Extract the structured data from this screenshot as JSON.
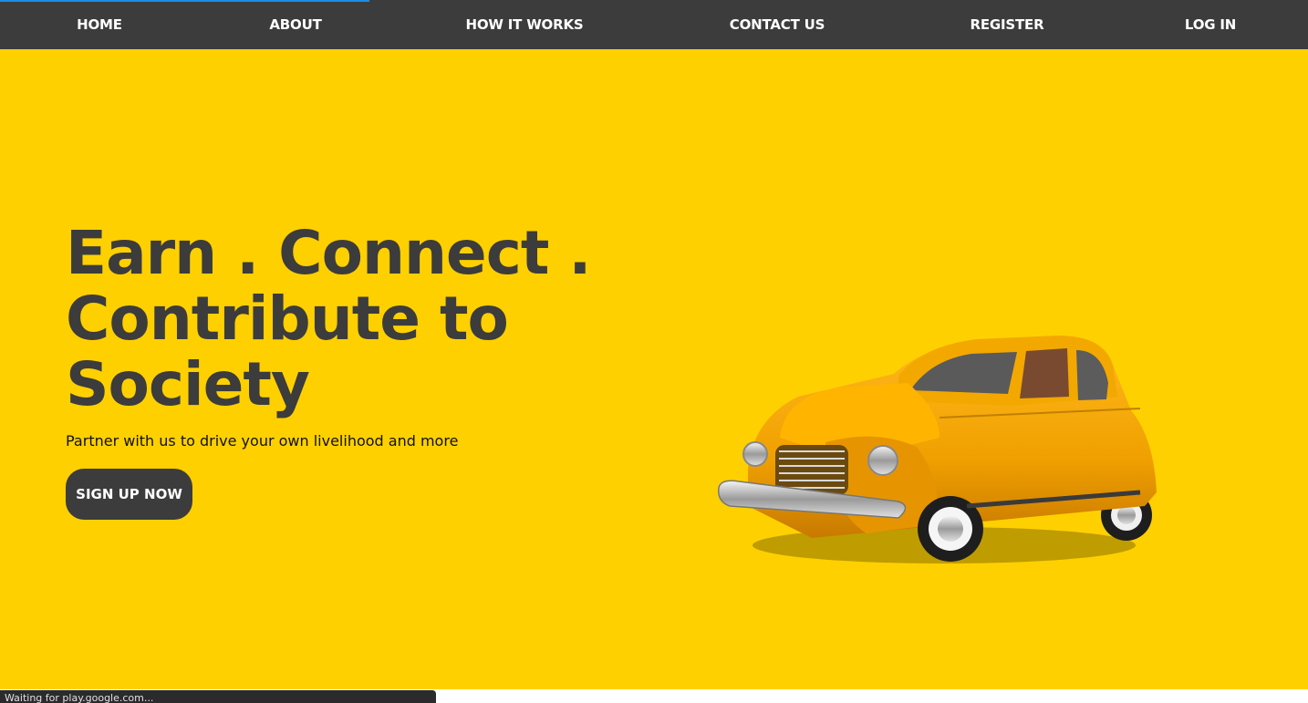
{
  "nav": {
    "items": [
      {
        "label": "HOME"
      },
      {
        "label": "ABOUT"
      },
      {
        "label": "HOW IT WORKS"
      },
      {
        "label": "CONTACT US"
      },
      {
        "label": "REGISTER"
      },
      {
        "label": "LOG IN"
      }
    ]
  },
  "hero": {
    "headline": "Earn . Connect . Contribute to Society",
    "subheadline": "Partner with us to drive your own livelihood and more",
    "cta_label": "SIGN UP NOW",
    "image": "vintage-yellow-taxi-car"
  },
  "status_bar": {
    "text": "Waiting for play.google.com..."
  },
  "colors": {
    "nav_background": "#3c3c3c",
    "hero_background": "#ffd000",
    "headline": "#3c3c3c",
    "button": "#3c3c3c",
    "loading_bar": "#1a8fe8",
    "car_body": "#f5a300"
  }
}
